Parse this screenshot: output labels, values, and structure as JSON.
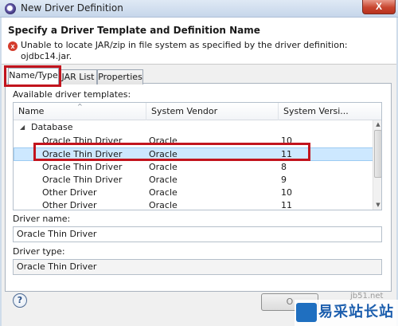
{
  "window": {
    "title": "New Driver Definition",
    "close_glyph": "X"
  },
  "header": {
    "title": "Specify a Driver Template and Definition Name",
    "error_icon_glyph": "x",
    "message_line1": "Unable to locate JAR/zip in file system as specified by the driver definition:",
    "message_line2": "ojdbc14.jar."
  },
  "tabs": [
    {
      "label": "Name/Type",
      "active": true
    },
    {
      "label": "JAR List",
      "active": false
    },
    {
      "label": "Properties",
      "active": false
    }
  ],
  "templates": {
    "label": "Available driver templates:",
    "columns": [
      "Name",
      "System Vendor",
      "System Versi..."
    ],
    "group": "Database",
    "rows": [
      {
        "name": "Oracle Thin Driver",
        "vendor": "Oracle",
        "version": "10",
        "selected": false
      },
      {
        "name": "Oracle Thin Driver",
        "vendor": "Oracle",
        "version": "11",
        "selected": true
      },
      {
        "name": "Oracle Thin Driver",
        "vendor": "Oracle",
        "version": "8",
        "selected": false
      },
      {
        "name": "Oracle Thin Driver",
        "vendor": "Oracle",
        "version": "9",
        "selected": false
      },
      {
        "name": "Other Driver",
        "vendor": "Oracle",
        "version": "10",
        "selected": false
      },
      {
        "name": "Other Driver",
        "vendor": "Oracle",
        "version": "11",
        "selected": false
      }
    ]
  },
  "driver_name": {
    "label": "Driver name:",
    "value": "Oracle Thin Driver"
  },
  "driver_type": {
    "label": "Driver type:",
    "value": "Oracle Thin Driver"
  },
  "buttons": {
    "help_glyph": "?",
    "ok_label": "O"
  },
  "watermark": {
    "text": "易采站长站",
    "site": "jb51.net",
    "logo_text": ""
  },
  "colors": {
    "highlight": "#c2141d",
    "selection": "#cde8ff",
    "error": "#d43c2c"
  }
}
